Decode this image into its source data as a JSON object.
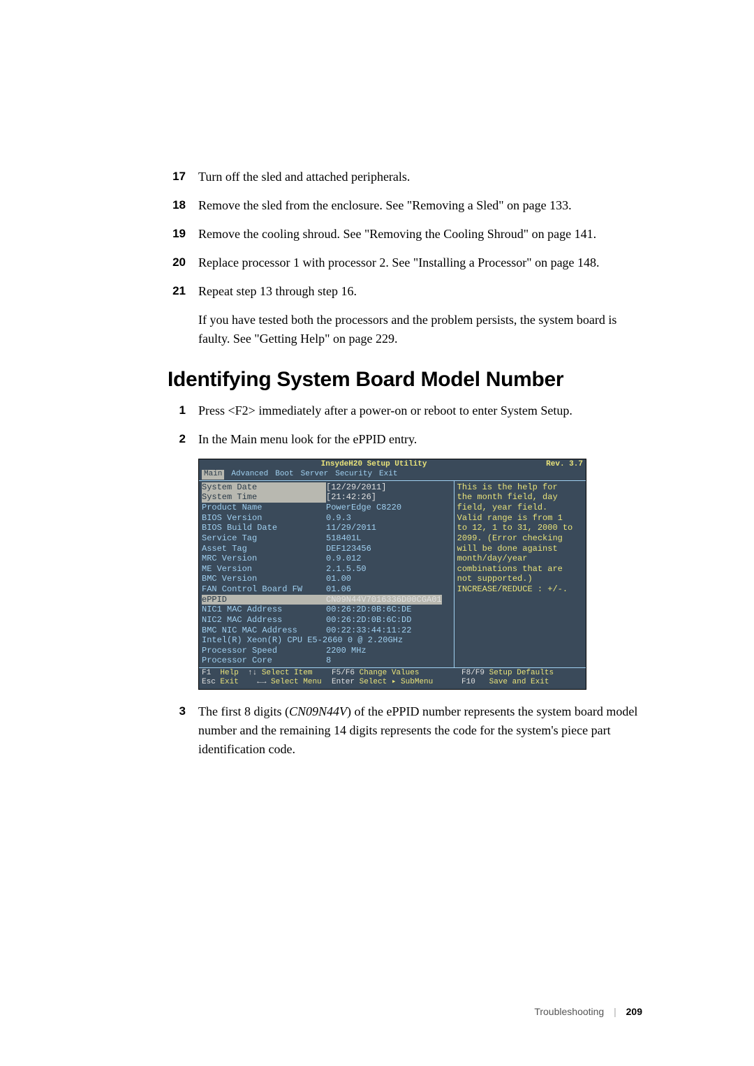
{
  "steps_top": [
    {
      "n": "17",
      "t": "Turn off the sled and attached peripherals."
    },
    {
      "n": "18",
      "t": "Remove the sled from the enclosure. See \"Removing a Sled\" on page 133."
    },
    {
      "n": "19",
      "t": "Remove the cooling shroud. See \"Removing the Cooling Shroud\" on page 141."
    },
    {
      "n": "20",
      "t": "Replace processor 1 with processor 2. See \"Installing a Processor\" on page 148."
    },
    {
      "n": "21",
      "t": "Repeat step 13 through step 16."
    }
  ],
  "step21_cont": "If you have tested both the processors and the problem persists, the system board is faulty. See \"Getting Help\" on page 229.",
  "heading": "Identifying System Board Model Number",
  "steps_bottom": [
    {
      "n": "1",
      "t": "Press <F2> immediately after a power-on or reboot to enter System Setup."
    },
    {
      "n": "2",
      "t": "In the Main menu look for the ePPID entry."
    }
  ],
  "step3_n": "3",
  "step3_pre": "The first 8 digits (",
  "step3_italic": "CN09N44V",
  "step3_post": ") of the ePPID number represents the system board model number and the remaining 14 digits represents the code for the system's piece part identification code.",
  "bios": {
    "title": "InsydeH20 Setup Utility",
    "rev": "Rev. 3.7",
    "menu": [
      "Main",
      "Advanced",
      "Boot",
      "Server",
      "Security",
      "Exit"
    ],
    "menu_active": "Main",
    "rows": [
      {
        "label": "System Date",
        "val": "[12/29/2011]",
        "hl": true
      },
      {
        "label": "System Time",
        "val": "[21:42:26]",
        "hlLabel": true
      },
      {
        "label": "",
        "val": ""
      },
      {
        "label": "Product Name",
        "val": "PowerEdge C8220"
      },
      {
        "label": "BIOS Version",
        "val": "0.9.3"
      },
      {
        "label": "BIOS Build Date",
        "val": "11/29/2011"
      },
      {
        "label": "Service Tag",
        "val": "518401L"
      },
      {
        "label": "Asset Tag",
        "val": "DEF123456"
      },
      {
        "label": "MRC Version",
        "val": "0.9.012"
      },
      {
        "label": "ME Version",
        "val": "2.1.5.50"
      },
      {
        "label": "BMC Version",
        "val": "01.00"
      },
      {
        "label": "FAN Control Board FW",
        "val": "01.06"
      },
      {
        "label": "ePPID",
        "val": "CN09N44V7016336D00CGA01",
        "hl2": true
      },
      {
        "label": "NIC1 MAC Address",
        "val": "00:26:2D:0B:6C:DE"
      },
      {
        "label": "NIC2 MAC Address",
        "val": "00:26:2D:0B:6C:DD"
      },
      {
        "label": "BMC NIC MAC Address",
        "val": "00:22:33:44:11:22"
      },
      {
        "label": "Intel(R) Xeon(R) CPU E5-2660 0 @ 2.20GHz",
        "val": "",
        "full": true
      },
      {
        "label": "Processor Speed",
        "val": "2200 MHz"
      },
      {
        "label": "Processor Core",
        "val": "8"
      }
    ],
    "help": [
      "This is the help for",
      "the month field, day",
      "field, year field.",
      "Valid range is from 1",
      "to 12, 1 to 31, 2000 to",
      "2099. (Error checking",
      "will be done against",
      "month/day/year",
      "combinations that are",
      "not supported.)",
      "INCREASE/REDUCE : +/-."
    ],
    "foot": {
      "r1": {
        "k1": "F1",
        "t1": "Help",
        "k2": "↑↓",
        "t2": "Select Item",
        "k3": "F5/F6",
        "t3": "Change Values",
        "k4": "F8/F9",
        "t4": "Setup Defaults"
      },
      "r2": {
        "k1": "Esc",
        "t1": "Exit",
        "k2": "←→",
        "t2": "Select Menu",
        "k3": "Enter",
        "t3": "Select ▸ SubMenu",
        "k4": "F10",
        "t4": "Save and Exit"
      }
    }
  },
  "footer": {
    "section": "Troubleshooting",
    "sep": "|",
    "page": "209"
  }
}
